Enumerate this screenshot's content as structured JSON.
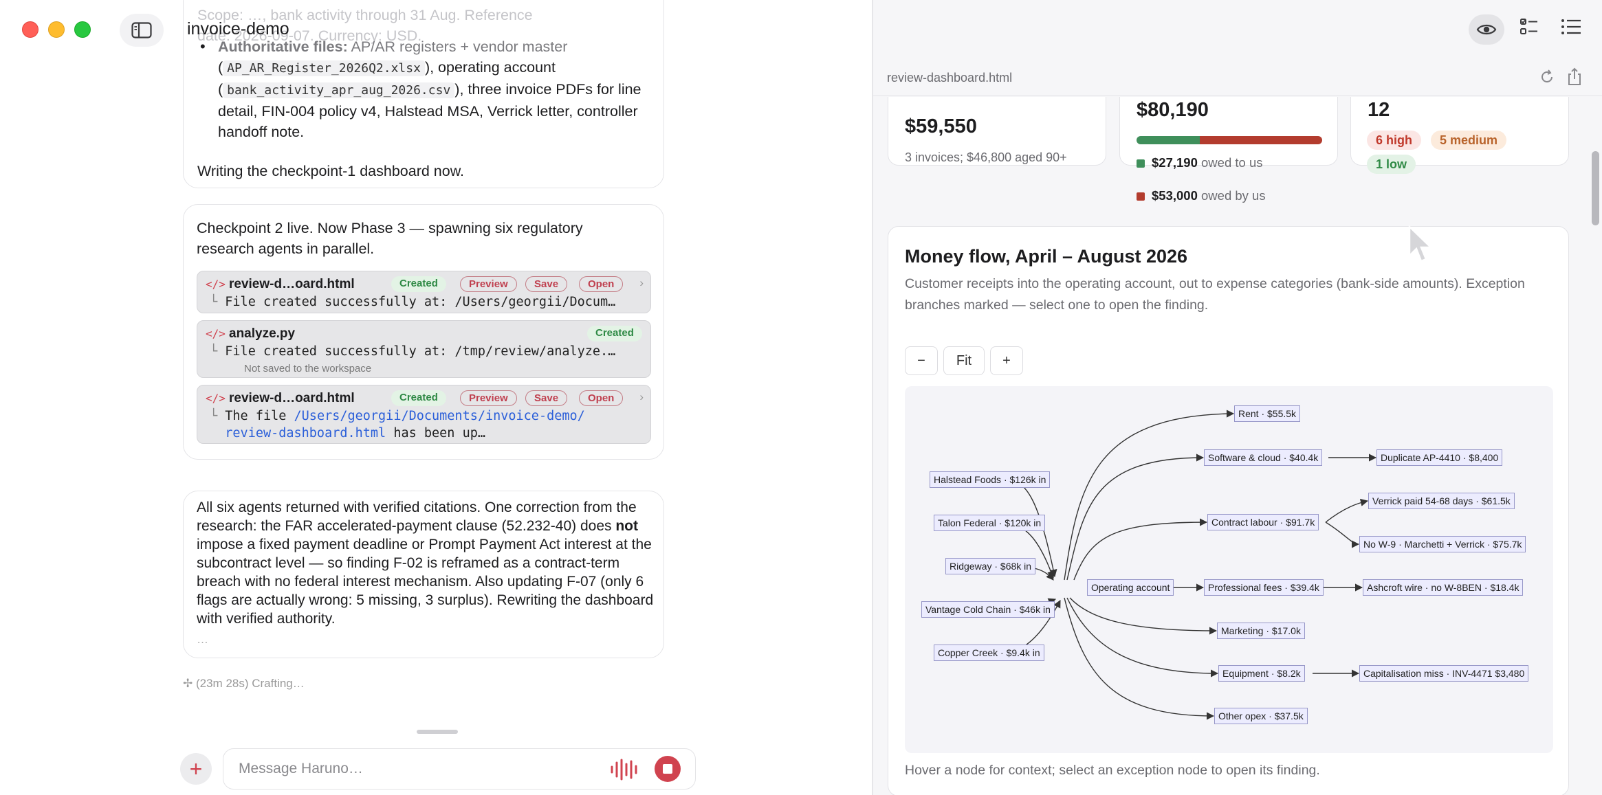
{
  "app": {
    "title": "invoice-demo"
  },
  "chat": {
    "card1": {
      "faded_top": "Scope: …, bank activity through 31 Aug. Reference",
      "faded_second": "date: 2026-09-07. Currency: USD.",
      "authoritative_label": "Authoritative files:",
      "authoritative_text": " AP/AR registers + vendor master",
      "file_register": "AP_AR_Register_2026Q2.xlsx",
      "after_register": "), operating account",
      "file_bank": "bank_activity_apr_aug_2026.csv",
      "after_bank": "), three invoice PDFs for line detail, FIN-004 policy v4, Halstead MSA, Verrick letter, controller handoff note.",
      "closing": "Writing the checkpoint-1 dashboard now."
    },
    "card2": {
      "text": "Checkpoint 2 live. Now Phase 3 — spawning six regulatory research agents in parallel.",
      "tools": [
        {
          "name": "review-d…oard.html",
          "status": "Created",
          "actions": [
            "Preview",
            "Save",
            "Open"
          ],
          "output": "File created successfully at: /Users/georgii/Docum…"
        },
        {
          "name": "analyze.py",
          "status": "Created",
          "output": "File created successfully at: /tmp/review/analyze.…",
          "note": "Not saved to the workspace"
        },
        {
          "name": "review-d…oard.html",
          "status": "Created",
          "actions": [
            "Preview",
            "Save",
            "Open"
          ],
          "output_prefix": "The file ",
          "output_link_1": "/Users/georgii/Documents/invoice-demo/",
          "output_link_2": "review-dashboard.html",
          "output_suffix": " has been up…"
        }
      ]
    },
    "card3": {
      "text_1": "All six agents returned with verified citations. One correction from the research: the FAR accelerated-payment clause (52.232-40) does ",
      "text_bold": "not",
      "text_2": " impose a fixed payment deadline or Prompt Payment Act interest at the subcontract level — so finding F-02 is reframed as a contract-term breach with no federal interest mechanism. Also updating F-07 (only 6 flags are actually wrong: 5 missing, 3 surplus). Rewriting the dashboard with verified authority.",
      "ellipsis": "…"
    },
    "status": "(23m 28s) Crafting…",
    "composer_placeholder": "Message Haruno…"
  },
  "preview": {
    "file_name": "review-dashboard.html",
    "kpi": {
      "aging_value": "$59,550",
      "aging_sub": "3 invoices; $46,800 aged 90+",
      "net_value": "$80,190",
      "owed_to_us_amount": "$27,190",
      "owed_to_us_label": " owed to us",
      "owed_by_us_amount": "$53,000",
      "owed_by_us_label": " owed by us",
      "bar_share_owed_to_us": 0.339,
      "findings_count": "12",
      "high": "6 high",
      "medium": "5 medium",
      "low": "1 low"
    },
    "flow": {
      "title": "Money flow, April – August 2026",
      "description": "Customer receipts into the operating account, out to expense categories (bank-side amounts). Exception branches marked — select one to open the finding.",
      "zoom_minus": "−",
      "zoom_fit": "Fit",
      "zoom_plus": "+",
      "sources": [
        "Halstead Foods · $126k in",
        "Talon Federal · $120k in",
        "Ridgeway · $68k in",
        "Vantage Cold Chain · $46k in",
        "Copper Creek · $9.4k in"
      ],
      "hub": "Operating account",
      "categories": [
        "Rent · $55.5k",
        "Software & cloud · $40.4k",
        "Contract labour · $91.7k",
        "Professional fees · $39.4k",
        "Marketing · $17.0k",
        "Equipment · $8.2k",
        "Other opex · $37.5k"
      ],
      "exceptions": [
        "Duplicate AP-4410 · $8,400",
        "Verrick paid 54-68 days · $61.5k",
        "No W-9 · Marchetti + Verrick · $75.7k",
        "Ashcroft wire · no W-8BEN · $18.4k",
        "Capitalisation miss · INV-4471 $3,480"
      ],
      "footer": "Hover a node for context; select an exception node to open its finding."
    }
  },
  "colors": {
    "accent": "#d0434f",
    "owed_to_us": "#3f8f5b",
    "owed_by_us": "#b33c2e"
  }
}
